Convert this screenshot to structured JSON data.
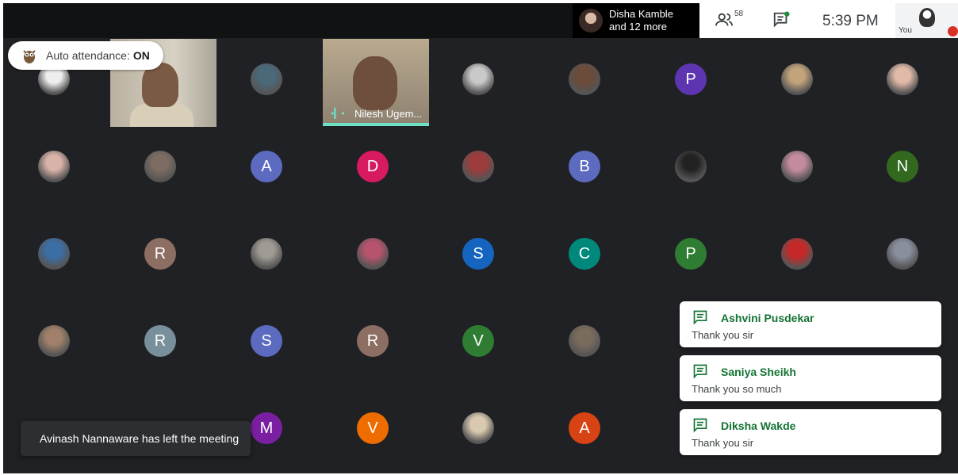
{
  "header": {
    "speaker_name": "Disha Kamble",
    "speaker_more": "and 12 more",
    "participants_count": "58",
    "time": "5:39 PM",
    "self_label": "You"
  },
  "auto_attendance": {
    "label": "Auto attendance:",
    "state": "ON"
  },
  "featured_tile": {
    "name": "Nilesh Ugem..."
  },
  "grid": [
    {
      "kind": "photo",
      "color": "#eeeeee"
    },
    {
      "kind": "video-left"
    },
    {
      "kind": "photo",
      "color": "#4a6a7a"
    },
    {
      "kind": "video-featured"
    },
    {
      "kind": "photo",
      "color": "#c9c9c9"
    },
    {
      "kind": "photo",
      "color": "#6b4b3a"
    },
    {
      "kind": "letter",
      "letter": "P",
      "color": "#5e35b1"
    },
    {
      "kind": "photo",
      "color": "#c2a37a"
    },
    {
      "kind": "photo",
      "color": "#e0b9a8"
    },
    {
      "kind": "photo",
      "color": "#d9b2a8"
    },
    {
      "kind": "photo",
      "color": "#7d6c62"
    },
    {
      "kind": "letter",
      "letter": "A",
      "color": "#5c6bc0"
    },
    {
      "kind": "letter",
      "letter": "D",
      "color": "#d81b60"
    },
    {
      "kind": "photo",
      "color": "#9e3b3b"
    },
    {
      "kind": "letter",
      "letter": "B",
      "color": "#5c6bc0"
    },
    {
      "kind": "photo",
      "color": "#222222"
    },
    {
      "kind": "photo",
      "color": "#c48b9f"
    },
    {
      "kind": "letter",
      "letter": "N",
      "color": "#33691e"
    },
    {
      "kind": "photo",
      "color": "#3b6ea5"
    },
    {
      "kind": "letter",
      "letter": "R",
      "color": "#8d6e63"
    },
    {
      "kind": "photo",
      "color": "#a09a94"
    },
    {
      "kind": "photo",
      "color": "#b8536d"
    },
    {
      "kind": "letter",
      "letter": "S",
      "color": "#1565c0"
    },
    {
      "kind": "letter",
      "letter": "C",
      "color": "#00897b"
    },
    {
      "kind": "letter",
      "letter": "P",
      "color": "#2e7d32"
    },
    {
      "kind": "photo",
      "color": "#c62828"
    },
    {
      "kind": "photo",
      "color": "#8a8fa0"
    },
    {
      "kind": "photo",
      "color": "#a0806a"
    },
    {
      "kind": "letter",
      "letter": "R",
      "color": "#78909c"
    },
    {
      "kind": "letter",
      "letter": "S",
      "color": "#5c6bc0"
    },
    {
      "kind": "letter",
      "letter": "R",
      "color": "#8d6e63"
    },
    {
      "kind": "letter",
      "letter": "V",
      "color": "#2e7d32"
    },
    {
      "kind": "photo",
      "color": "#7a6b5d"
    },
    {
      "kind": "hidden"
    },
    {
      "kind": "hidden"
    },
    {
      "kind": "hidden"
    },
    {
      "kind": "hidden"
    },
    {
      "kind": "hidden"
    },
    {
      "kind": "letter",
      "letter": "M",
      "color": "#7b1fa2"
    },
    {
      "kind": "letter",
      "letter": "V",
      "color": "#ef6c00"
    },
    {
      "kind": "photo",
      "color": "#d9c9b0"
    },
    {
      "kind": "letter",
      "letter": "A",
      "color": "#d84315"
    },
    {
      "kind": "hidden"
    },
    {
      "kind": "hidden"
    },
    {
      "kind": "hidden"
    }
  ],
  "chat_toasts": [
    {
      "name": "Ashvini Pusdekar",
      "message": "Thank you sir"
    },
    {
      "name": "Saniya Sheikh",
      "message": "Thank you so much"
    },
    {
      "name": "Diksha Wakde",
      "message": "Thank you sir"
    }
  ],
  "left_notification": "Avinash Nannaware has left the meeting",
  "colors": {
    "accent": "#1e8e3e",
    "speaking_bar": "#6ee0c6",
    "mute_red": "#d93025"
  }
}
